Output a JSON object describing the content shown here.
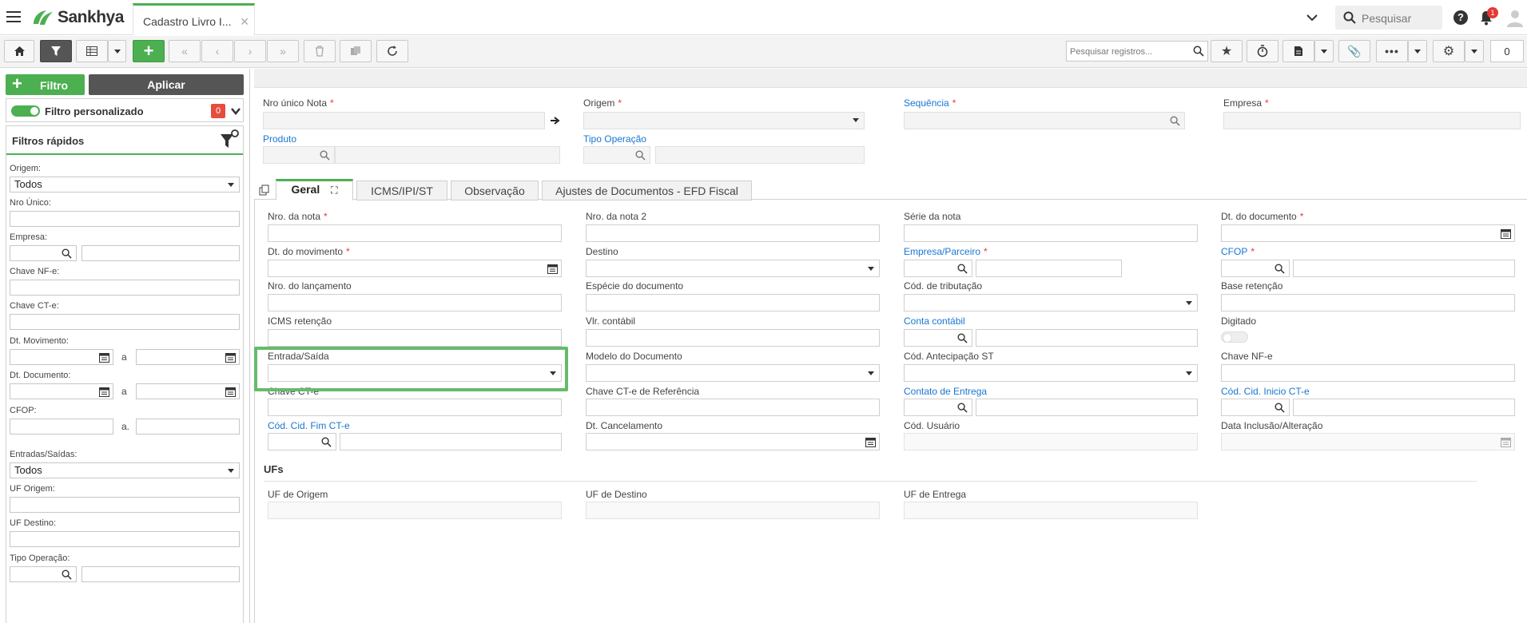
{
  "app": {
    "brand": "Sankhya",
    "tab_title": "Cadastro Livro I...",
    "search_placeholder": "Pesquisar",
    "notification_count": "1"
  },
  "toolbar": {
    "search_placeholder": "Pesquisar registros...",
    "record_count": "0"
  },
  "filters_panel": {
    "add_filter_label": "Filtro",
    "apply_label": "Aplicar",
    "custom_filter_label": "Filtro personalizado",
    "custom_filter_count": "0",
    "quick_filters_title": "Filtros rápidos",
    "fields": {
      "origem_label": "Origem:",
      "origem_value": "Todos",
      "nro_unico_label": "Nro Único:",
      "empresa_label": "Empresa:",
      "chave_nfe_label": "Chave NF-e:",
      "chave_cte_label": "Chave CT-e:",
      "dt_movimento_label": "Dt. Movimento:",
      "dt_documento_label": "Dt. Documento:",
      "cfop_label": "CFOP:",
      "entradas_saidas_label": "Entradas/Saídas:",
      "entradas_saidas_value": "Todos",
      "uf_origem_label": "UF Origem:",
      "uf_destino_label": "UF Destino:",
      "tipo_operacao_label": "Tipo Operação:",
      "range_sep": "a",
      "cfop_sep": "a."
    }
  },
  "header_fields": {
    "nro_unico_nota": "Nro único Nota",
    "origem": "Origem",
    "sequencia": "Sequência",
    "empresa": "Empresa",
    "produto": "Produto",
    "tipo_operacao": "Tipo Operação",
    "required_mark": "*"
  },
  "tabs": [
    {
      "label": "Geral"
    },
    {
      "label": "ICMS/IPI/ST"
    },
    {
      "label": "Observação"
    },
    {
      "label": "Ajustes de Documentos - EFD Fiscal"
    }
  ],
  "form": {
    "nro_nota": "Nro. da nota",
    "nro_nota2": "Nro. da nota 2",
    "serie_nota": "Série da nota",
    "dt_documento": "Dt. do documento",
    "dt_movimento": "Dt. do movimento",
    "destino": "Destino",
    "empresa_parceiro": "Empresa/Parceiro",
    "cfop": "CFOP",
    "nro_lancamento": "Nro. do lançamento",
    "especie_documento": "Espécie do documento",
    "cod_tributacao": "Cód. de tributação",
    "base_retencao": "Base retenção",
    "icms_retencao": "ICMS retenção",
    "vlr_contabil": "Vlr. contábil",
    "conta_contabil": "Conta contábil",
    "digitado": "Digitado",
    "entrada_saida": "Entrada/Saída",
    "modelo_documento": "Modelo do Documento",
    "cod_antecipacao_st": "Cód. Antecipação ST",
    "chave_nfe": "Chave NF-e",
    "chave_cte": "Chave CT-e",
    "chave_cte_ref": "Chave CT-e de Referência",
    "contato_entrega": "Contato de Entrega",
    "cod_cid_inicio_cte": "Cód. Cid. Inicio CT-e",
    "cod_cid_fim_cte": "Cód. Cid. Fim CT-e",
    "dt_cancelamento": "Dt. Cancelamento",
    "cod_usuario": "Cód. Usuário",
    "data_inclusao": "Data Inclusão/Alteração"
  },
  "ufs": {
    "title": "UFs",
    "uf_origem": "UF de Origem",
    "uf_destino": "UF de Destino",
    "uf_entrega": "UF de Entrega"
  },
  "colors": {
    "accent_green": "#4caf50",
    "link_blue": "#1976d2",
    "required_red": "#e53935",
    "highlight_green": "#66bb6a"
  }
}
